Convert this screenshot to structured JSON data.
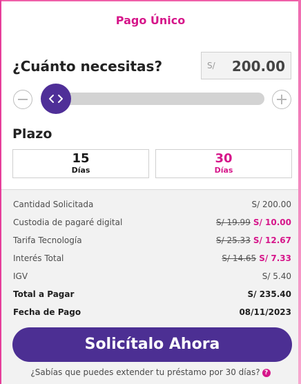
{
  "header": {
    "title": "Pago Único"
  },
  "amount": {
    "question": "¿Cuánto necesitas?",
    "currency": "S/",
    "value": "200.00"
  },
  "slider": {
    "min_icon": "minus-circle-icon",
    "max_icon": "plus-circle-icon",
    "knob_icon": "chevrons-left-right-icon",
    "level": 0.0
  },
  "plazo": {
    "label": "Plazo",
    "options": [
      {
        "number": "15",
        "unit": "Días",
        "selected": false
      },
      {
        "number": "30",
        "unit": "Días",
        "selected": true
      }
    ]
  },
  "summary": {
    "rows": [
      {
        "label": "Cantidad Solicitada",
        "value": "S/ 200.00"
      },
      {
        "label": "Custodia de pagaré digital",
        "old": "S/ 19.99",
        "new": "S/ 10.00"
      },
      {
        "label": "Tarifa Tecnología",
        "old": "S/ 25.33",
        "new": "S/ 12.67"
      },
      {
        "label": "Interés Total",
        "old": "S/ 14.65",
        "new": "S/ 7.33"
      },
      {
        "label": "IGV",
        "value": "S/ 5.40"
      },
      {
        "label": "Total a Pagar",
        "value": "S/ 235.40"
      },
      {
        "label": "Fecha de Pago",
        "value": "08/11/2023"
      }
    ]
  },
  "cta": {
    "label": "Solicítalo Ahora"
  },
  "hint": {
    "text": "¿Sabías que puedes extender tu préstamo por 30 días?",
    "icon_glyph": "?"
  },
  "colors": {
    "accent": "#d6168a",
    "primary": "#4c2f93",
    "frame": "#ef5fa8"
  }
}
